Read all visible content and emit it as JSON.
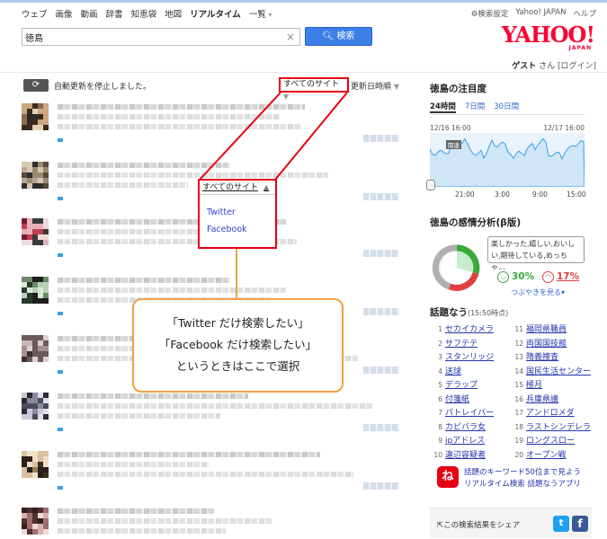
{
  "nav": {
    "links": [
      "ウェブ",
      "画像",
      "動画",
      "辞書",
      "知恵袋",
      "地図",
      "リアルタイム",
      "一覧"
    ],
    "active": "リアルタイム",
    "settings": "検索設定",
    "yahoo_japan": "Yahoo! JAPAN",
    "help": "ヘルプ"
  },
  "search": {
    "value": "徳島",
    "clear": "×",
    "button": "検索",
    "button_icon": "search-icon"
  },
  "logo": {
    "text": "YAHOO!",
    "sub": "JAPAN"
  },
  "user": {
    "name": "ゲスト",
    "suffix": "さん",
    "login": "[ログイン]"
  },
  "controls": {
    "refresh_icon": "refresh-icon",
    "status": "自動更新を停止しました。",
    "site_filter": "すべてのサイト",
    "sort": "更新日時順"
  },
  "dropdown": {
    "selected": "すべてのサイト",
    "options": [
      "Twitter",
      "Facebook"
    ]
  },
  "callout": {
    "lines": [
      "「Twitter だけ検索したい」",
      "「Facebook だけ検索したい」",
      "というときはここで選択"
    ]
  },
  "trend": {
    "title": "徳島の注目度",
    "tabs": [
      "24時間",
      "7日間",
      "30日間"
    ],
    "start_label": "12/16 16:00",
    "end_label": "12/17 16:00",
    "badge": "関連",
    "x_ticks": [
      "21:00",
      "3:00",
      "9:00",
      "15:00"
    ]
  },
  "emotion": {
    "title": "徳島の感情分析(β版)",
    "bubble": "楽しかった,嬉しい,おいしい,期待している,めっちゃ...",
    "positive": "30%",
    "negative": "17%",
    "see_tweets": "つぶやきを見る▾",
    "positive_color": "#3aa83a",
    "negative_color": "#e04040"
  },
  "hot": {
    "title": "話題なう",
    "time": "(15:50時点)",
    "items": [
      {
        "rank": "1",
        "kw": "セカイカメラ"
      },
      {
        "rank": "2",
        "kw": "サフテテ"
      },
      {
        "rank": "3",
        "kw": "スタンリッジ"
      },
      {
        "rank": "4",
        "kw": "送球"
      },
      {
        "rank": "5",
        "kw": "デラップ"
      },
      {
        "rank": "6",
        "kw": "付箋紙"
      },
      {
        "rank": "7",
        "kw": "パトレイバー"
      },
      {
        "rank": "8",
        "kw": "カピバラ女"
      },
      {
        "rank": "9",
        "kw": "ipアドレス"
      },
      {
        "rank": "10",
        "kw": "違辺容疑者"
      },
      {
        "rank": "11",
        "kw": "福岡県職員"
      },
      {
        "rank": "12",
        "kw": "両国国技館"
      },
      {
        "rank": "13",
        "kw": "隋義捜査"
      },
      {
        "rank": "14",
        "kw": "国民生活センター"
      },
      {
        "rank": "15",
        "kw": "極月"
      },
      {
        "rank": "16",
        "kw": "兵庫県議"
      },
      {
        "rank": "17",
        "kw": "アンドロメダ"
      },
      {
        "rank": "18",
        "kw": "ラストシンデレラ"
      },
      {
        "rank": "19",
        "kw": "ロングスロー"
      },
      {
        "rank": "20",
        "kw": "オープン戦"
      }
    ]
  },
  "app": {
    "icon": "ね",
    "line1": "話題のキーワード50位まで見よう",
    "line2": "リアルタイム検索 話題なうアプリ"
  },
  "share": {
    "text": "この検索結果をシェア",
    "twitter": "t",
    "facebook": "f"
  }
}
